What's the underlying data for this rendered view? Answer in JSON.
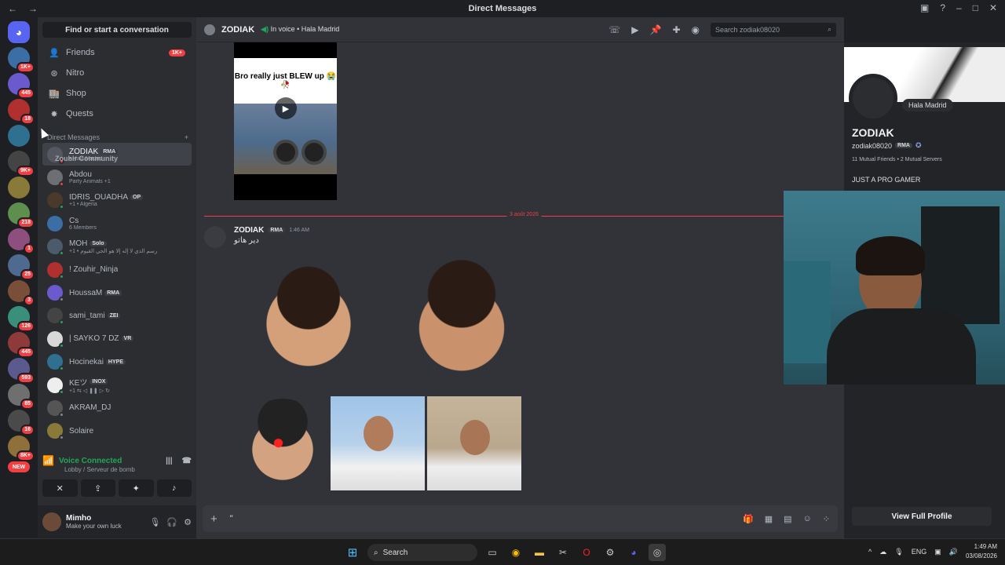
{
  "window": {
    "title": "Direct Messages",
    "back": "←",
    "forward": "→"
  },
  "servers": [
    {
      "badge": "1K+"
    },
    {
      "badge": "445"
    },
    {
      "badge": "18"
    },
    {
      "badge": ""
    },
    {
      "badge": "9K+"
    },
    {
      "badge": ""
    },
    {
      "badge": "218"
    },
    {
      "badge": "1"
    },
    {
      "badge": "25"
    },
    {
      "badge": "3"
    },
    {
      "badge": "126"
    },
    {
      "badge": "445"
    },
    {
      "badge": "593"
    },
    {
      "badge": "85"
    },
    {
      "badge": "16"
    },
    {
      "badge": "8K+"
    }
  ],
  "servers_new": "NEW",
  "sidebar": {
    "search": "Find or start a conversation",
    "nav": [
      {
        "label": "Friends",
        "count": "1K+"
      },
      {
        "label": "Nitro",
        "count": ""
      },
      {
        "label": "Shop",
        "count": ""
      },
      {
        "label": "Quests",
        "count": ""
      }
    ],
    "dm_header": "Direct Messages",
    "dm_add": "+",
    "dms": [
      {
        "name": "ZODIAK",
        "tag": "RMA",
        "sub": "• Hala Madrid",
        "color": "#55585e",
        "status": "#f23f43",
        "active": true
      },
      {
        "name": "Abdou",
        "tag": "",
        "sub": "Party Animals +1",
        "color": "#6e6f73",
        "status": "#f23f43"
      },
      {
        "name": "IDRIS_OUADHA",
        "tag": "OP",
        "sub": "+1 • Algeria",
        "color": "#4a3a2a",
        "status": "#23a55a"
      },
      {
        "name": "Cs",
        "tag": "",
        "sub": "6 Members",
        "color": "#3a6ea5",
        "status": ""
      },
      {
        "name": "MOH",
        "tag": "Solo",
        "sub": "+1 • رسم الذي لا إله إلا هو الحي القيوم",
        "color": "#4b5b6b",
        "status": "#23a55a"
      },
      {
        "name": "! Zouhir_Ninja",
        "tag": "",
        "sub": "",
        "color": "#b03030",
        "status": "#23a55a"
      },
      {
        "name": "HoussaM",
        "tag": "RMA",
        "sub": "",
        "color": "#6a5acd",
        "status": "#80848e"
      },
      {
        "name": "sami_tami",
        "tag": "ZEI",
        "sub": "",
        "color": "#444",
        "status": "#23a55a"
      },
      {
        "name": "| SAYKO 7 DZ",
        "tag": "VR",
        "sub": "",
        "color": "#d8d8d8",
        "status": "#23a55a"
      },
      {
        "name": "Hocinekai",
        "tag": "HYPE",
        "sub": "",
        "color": "#2f6f8f",
        "status": "#23a55a"
      },
      {
        "name": "KEツ",
        "tag": "INOX",
        "sub": "+1 ⇆ ◁ ❚❚ ▷ ↻",
        "color": "#eee",
        "status": "#23a55a"
      },
      {
        "name": "AKRAM_DJ",
        "tag": "",
        "sub": "",
        "color": "#555",
        "status": "#80848e"
      },
      {
        "name": "Solaire",
        "tag": "",
        "sub": "",
        "color": "#8a7a3a",
        "status": "#80848e"
      }
    ],
    "hover_tooltip": "Zoubir Community"
  },
  "voice": {
    "status": "Voice Connected",
    "channel": "Lobby / Serveur de bomb"
  },
  "user": {
    "name": "Mimho",
    "status": "Make your own luck"
  },
  "chat": {
    "header_name": "ZODIAK",
    "in_voice": "In voice",
    "voice_channel": "Hala Madrid",
    "search_placeholder": "Search zodiak08020",
    "video_caption": "Bro really just BLEW up 😭🥀",
    "divider_date": "3 août 2026",
    "msg_author": "ZODIAK",
    "msg_tag": "RMA",
    "msg_time": "1:46 AM",
    "msg_text": "دير هاتو",
    "composer_plus": "+",
    "composer_value": "\"",
    "emoji_icon": "☺"
  },
  "profile": {
    "status": "Hala Madrid",
    "name": "ZODIAK",
    "username": "zodiak08020",
    "tag": "RMA",
    "mutual": "11 Mutual Friends • 2 Mutual Servers",
    "bio": "JUST A PRO GAMER",
    "full_profile": "View Full Profile"
  },
  "taskbar": {
    "search": "Search",
    "lang": "ENG",
    "time": "1:49 AM",
    "date": "03/08/2026"
  }
}
